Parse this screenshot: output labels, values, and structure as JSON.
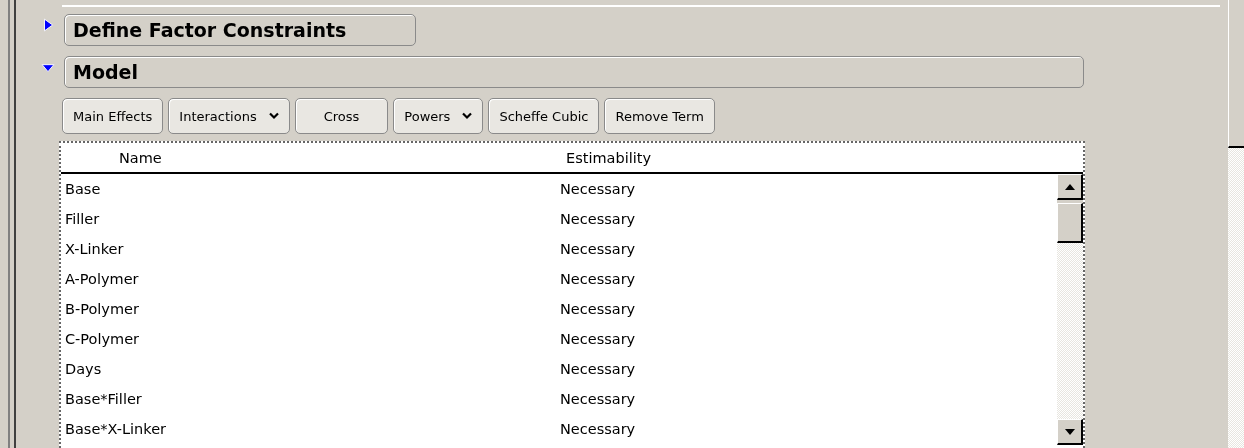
{
  "sections": [
    {
      "title": "Define Factor Constraints",
      "expanded": false
    },
    {
      "title": "Model",
      "expanded": true
    }
  ],
  "toolbar": [
    {
      "label": "Main Effects",
      "kind": "button"
    },
    {
      "label": "Interactions",
      "kind": "dropdown"
    },
    {
      "label": "Cross",
      "kind": "button"
    },
    {
      "label": "Powers",
      "kind": "dropdown"
    },
    {
      "label": "Scheffe Cubic",
      "kind": "button"
    },
    {
      "label": "Remove Term",
      "kind": "button"
    }
  ],
  "table": {
    "columns": [
      "Name",
      "Estimability"
    ],
    "rows": [
      [
        "Base",
        "Necessary"
      ],
      [
        "Filler",
        "Necessary"
      ],
      [
        "X-Linker",
        "Necessary"
      ],
      [
        "A-Polymer",
        "Necessary"
      ],
      [
        "B-Polymer",
        "Necessary"
      ],
      [
        "C-Polymer",
        "Necessary"
      ],
      [
        "Days",
        "Necessary"
      ],
      [
        "Base*Filler",
        "Necessary"
      ],
      [
        "Base*X-Linker",
        "Necessary"
      ]
    ]
  }
}
